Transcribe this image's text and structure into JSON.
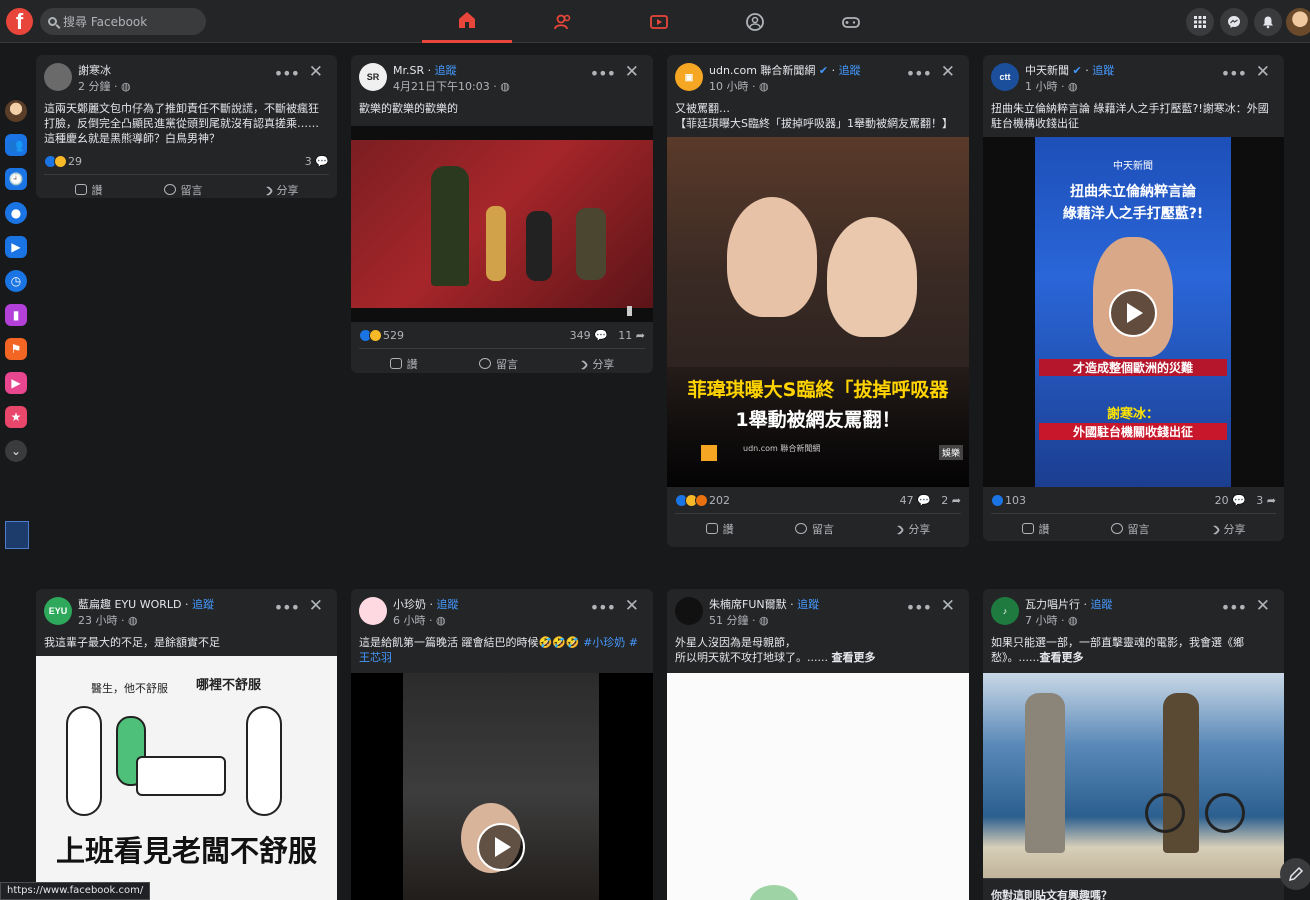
{
  "search": {
    "placeholder": "搜尋 Facebook"
  },
  "nav": {
    "tabs": [
      "home-icon",
      "friends-icon",
      "watch-icon",
      "groups-icon",
      "gaming-icon"
    ]
  },
  "accent": "#e8463a",
  "status_url": "https://www.facebook.com/",
  "posts": [
    {
      "author": "謝寒冰",
      "follow": "",
      "time": "2 分鐘",
      "text": "這兩天鄭麗文包巾仔為了推卸責任不斷說謊，不斷被瘋狂打臉，反倒完全凸顯民進黨從頭到尾就沒有認真搓乘……這種慶幺就是黑熊導師？白鳥男神？",
      "reactions": "29",
      "comments": "3",
      "shares": ""
    },
    {
      "author": "Mr.SR",
      "follow": "追蹤",
      "time": "4月21日下午10:03",
      "text": "歡樂的歡樂的歡樂的",
      "reactions": "529",
      "comments": "349",
      "shares": "11"
    },
    {
      "author": "udn.com 聯合新聞網",
      "follow": "追蹤",
      "time": "10 小時",
      "text": "又被罵翻…\n【菲廷琪曝大S臨終「拔掉呼吸器」1舉動被網友罵翻！】",
      "image_title_1": "菲瑋琪曝大S臨終「拔掉呼吸器",
      "image_title_2": "1舉動被網友罵翻！",
      "image_source": "udn.com 聯合新聞網",
      "image_tag": "娛樂",
      "reactions": "202",
      "comments": "47",
      "shares": "2"
    },
    {
      "author": "中天新聞",
      "follow": "追蹤",
      "time": "1 小時",
      "text": "扭曲朱立倫納粹言論 綠藉洋人之手打壓藍?!謝寒冰：外國駐台機構收錢出征",
      "image_brand": "中天新聞",
      "image_title_1": "扭曲朱立倫納粹言論",
      "image_title_2": "綠藉洋人之手打壓藍?!",
      "image_caption_1": "才造成整個歐洲的災難",
      "image_caption_2": "謝寒冰：",
      "image_caption_3": "外國駐台機關收錢出征",
      "reactions": "103",
      "comments": "20",
      "shares": "3"
    },
    {
      "author": "藍扁趣 EYU WORLD",
      "follow": "追蹤",
      "time": "23 小時",
      "text": "我這輩子最大的不足，是餘額實不足",
      "comic_line_1": "醫生，他不舒服",
      "comic_line_2": "哪裡不舒服",
      "comic_big": "上班看見老闆不舒服"
    },
    {
      "author": "小珍奶",
      "follow": "追蹤",
      "time": "6 小時",
      "text": "這是給飢第一篇晚活 躍會結巴的時候🤣🤣🤣 ",
      "tags": "#小珍奶 #王芯羽"
    },
    {
      "author": "朱楠席FUN爾默",
      "follow": "追蹤",
      "time": "51 分鐘",
      "text": "外星人沒因為是母親節，\n所以明天就不攻打地球了。......",
      "see_more": "查看更多"
    },
    {
      "author": "瓦力唱片行",
      "follow": "追蹤",
      "time": "7 小時",
      "text": "如果只能選一部，一部直擊靈魂的電影，我會選《鄉愁》。......",
      "see_more": "查看更多",
      "footer_question": "你對這則貼文有興趣嗎？"
    }
  ],
  "actions": {
    "like": "讚",
    "comment": "留言",
    "share": "分享"
  }
}
